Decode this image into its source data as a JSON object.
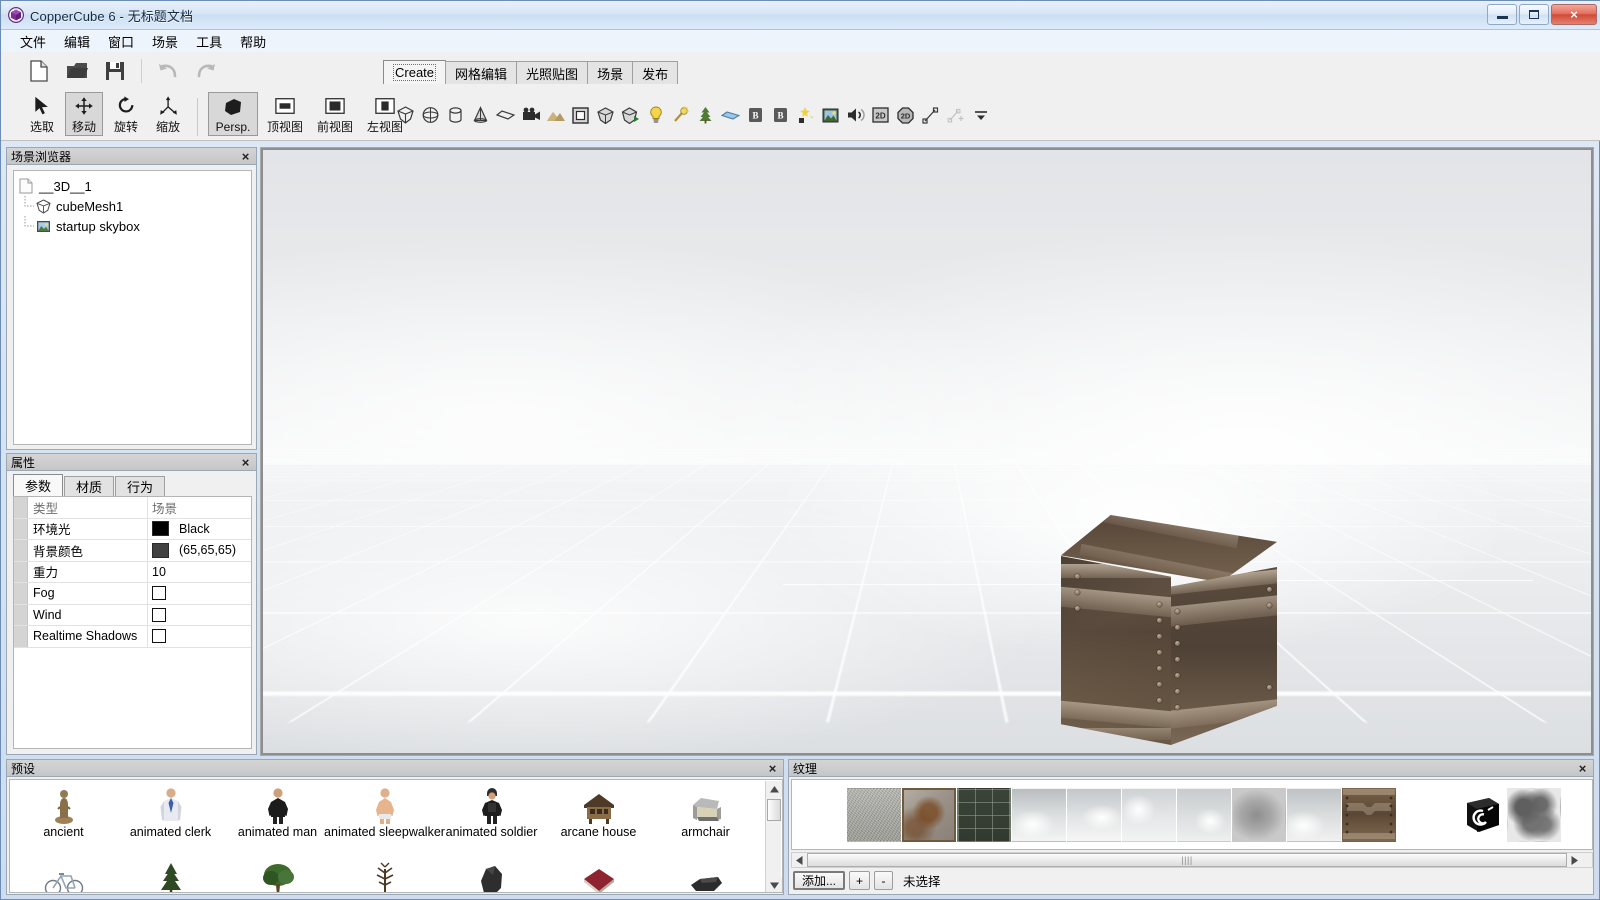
{
  "window": {
    "title": "CopperCube 6 - 无标题文档",
    "app_icon": "coppercube-logo-icon",
    "buttons": {
      "minimize": "minimize-icon",
      "maximize": "maximize-icon",
      "close": "×"
    }
  },
  "menubar": {
    "items": [
      {
        "label": "文件",
        "name": "menu-file"
      },
      {
        "label": "编辑",
        "name": "menu-edit"
      },
      {
        "label": "窗口",
        "name": "menu-window"
      },
      {
        "label": "场景",
        "name": "menu-scene"
      },
      {
        "label": "工具",
        "name": "menu-tools"
      },
      {
        "label": "帮助",
        "name": "menu-help"
      }
    ]
  },
  "toolbar": {
    "file_actions": [
      {
        "name": "new-document-button",
        "icon": "new-file-icon"
      },
      {
        "name": "open-document-button",
        "icon": "open-folder-icon"
      },
      {
        "name": "save-document-button",
        "icon": "save-disk-icon"
      },
      {
        "name": "undo-button",
        "icon": "undo-arrow-icon"
      },
      {
        "name": "redo-button",
        "icon": "redo-arrow-icon"
      }
    ],
    "transform_tools": [
      {
        "label": "选取",
        "name": "tool-select",
        "icon": "cursor-arrow-icon",
        "active": false
      },
      {
        "label": "移动",
        "name": "tool-move",
        "icon": "move-cross-icon",
        "active": true
      },
      {
        "label": "旋转",
        "name": "tool-rotate",
        "icon": "rotate-icon",
        "active": false
      },
      {
        "label": "缩放",
        "name": "tool-scale",
        "icon": "scale-icon",
        "active": false
      }
    ],
    "view_tools": [
      {
        "label": "Persp.",
        "name": "view-perspective",
        "icon": "perspective-cube-icon",
        "active": true
      },
      {
        "label": "顶视图",
        "name": "view-top",
        "icon": "top-view-icon",
        "active": false
      },
      {
        "label": "前视图",
        "name": "view-front",
        "icon": "front-view-icon",
        "active": false
      },
      {
        "label": "左视图",
        "name": "view-left",
        "icon": "left-view-icon",
        "active": false
      }
    ]
  },
  "tabs": {
    "items": [
      {
        "label": "Create",
        "name": "tab-create",
        "active": true
      },
      {
        "label": "网格编辑",
        "name": "tab-mesh-edit",
        "active": false
      },
      {
        "label": "光照贴图",
        "name": "tab-lightmap",
        "active": false
      },
      {
        "label": "场景",
        "name": "tab-scene",
        "active": false
      },
      {
        "label": "发布",
        "name": "tab-publish",
        "active": false
      }
    ]
  },
  "create_toolbar": {
    "icons": [
      "cube-icon",
      "sphere-icon",
      "cylinder-icon",
      "cone-icon",
      "plane-icon",
      "camera-icon",
      "terrain-icon",
      "room-icon",
      "model-icon",
      "model-animated-icon",
      "light-icon",
      "particle-icon",
      "tree-plant-icon",
      "water-icon",
      "billboard-b-icon",
      "text-b-icon",
      "sparkle-icon",
      "skybox-icon",
      "sound-icon",
      "overlay-2d-icon",
      "hud-2d-icon",
      "path-icon",
      "path-node-icon",
      "more-dropdown-icon"
    ]
  },
  "scene_browser": {
    "title": "场景浏览器",
    "close": "×",
    "nodes": [
      {
        "label": "__3D__1",
        "icon": "document-icon",
        "depth": 0,
        "name": "scene-node-3d-1"
      },
      {
        "label": "cubeMesh1",
        "icon": "cube-mesh-icon",
        "depth": 1,
        "name": "scene-node-cubemesh1"
      },
      {
        "label": "startup skybox",
        "icon": "skybox-node-icon",
        "depth": 1,
        "name": "scene-node-startup-skybox"
      }
    ]
  },
  "properties": {
    "title": "属性",
    "close": "×",
    "tabs": [
      {
        "label": "参数",
        "name": "prop-tab-parameters",
        "active": true
      },
      {
        "label": "材质",
        "name": "prop-tab-materials",
        "active": false
      },
      {
        "label": "行为",
        "name": "prop-tab-behaviors",
        "active": false
      }
    ],
    "columns": {
      "type": "类型",
      "value": "场景"
    },
    "rows": [
      {
        "name": "环境光",
        "value": "Black",
        "kind": "color",
        "swatch": "#000000"
      },
      {
        "name": "背景颜色",
        "value": "(65,65,65)",
        "kind": "color",
        "swatch": "#414141"
      },
      {
        "name": "重力",
        "value": "10",
        "kind": "text"
      },
      {
        "name": "Fog",
        "value": "",
        "kind": "checkbox",
        "checked": false
      },
      {
        "name": "Wind",
        "value": "",
        "kind": "checkbox",
        "checked": false
      },
      {
        "name": "Realtime Shadows",
        "value": "",
        "kind": "checkbox",
        "checked": false
      }
    ]
  },
  "presets": {
    "title": "预设",
    "close": "×",
    "row1": [
      {
        "label": "ancient",
        "thumb": "statue-thumb"
      },
      {
        "label": "animated clerk",
        "thumb": "clerk-thumb"
      },
      {
        "label": "animated man",
        "thumb": "man-thumb"
      },
      {
        "label": "animated sleepwalker",
        "thumb": "sleepwalker-thumb"
      },
      {
        "label": "animated soldier",
        "thumb": "soldier-thumb"
      },
      {
        "label": "arcane house",
        "thumb": "house-thumb"
      },
      {
        "label": "armchair",
        "thumb": "armchair-thumb"
      }
    ],
    "row2": [
      {
        "label": "",
        "thumb": "bicycle-thumb"
      },
      {
        "label": "",
        "thumb": "pine-tree-thumb"
      },
      {
        "label": "",
        "thumb": "broadleaf-tree-thumb"
      },
      {
        "label": "",
        "thumb": "bare-tree-thumb"
      },
      {
        "label": "",
        "thumb": "rock-thumb"
      },
      {
        "label": "",
        "thumb": "book-thumb"
      },
      {
        "label": "",
        "thumb": "boat-thumb"
      }
    ]
  },
  "textures": {
    "title": "纹理",
    "close": "×",
    "items": [
      {
        "name": "texture-concrete",
        "kind": "concrete"
      },
      {
        "name": "texture-rusty-metal",
        "kind": "rust"
      },
      {
        "name": "texture-dark-grid",
        "kind": "darkgrid"
      },
      {
        "name": "texture-sky-1",
        "kind": "sky1"
      },
      {
        "name": "texture-sky-2",
        "kind": "sky2"
      },
      {
        "name": "texture-sky-3",
        "kind": "sky3"
      },
      {
        "name": "texture-sky-4",
        "kind": "sky4"
      },
      {
        "name": "texture-cloud-gray",
        "kind": "cloudgray"
      },
      {
        "name": "texture-sky-5",
        "kind": "sky5"
      },
      {
        "name": "texture-crate",
        "kind": "crate"
      },
      {
        "name": "texture-white",
        "kind": "white"
      },
      {
        "name": "texture-logo-cube",
        "kind": "logocube"
      },
      {
        "name": "texture-blur-gray",
        "kind": "blurgray"
      }
    ],
    "add_button": "添加...",
    "plus_button": "+",
    "minus_button": "-",
    "status": "未选择"
  },
  "viewport": {
    "name": "3d-viewport",
    "object": "cubeMesh1",
    "camera": "Persp."
  },
  "colors": {
    "accent": "#3a6ea5",
    "panel_bg": "#f0f0f0",
    "panel_head": "#cccccc",
    "close_red": "#cf4a37"
  }
}
